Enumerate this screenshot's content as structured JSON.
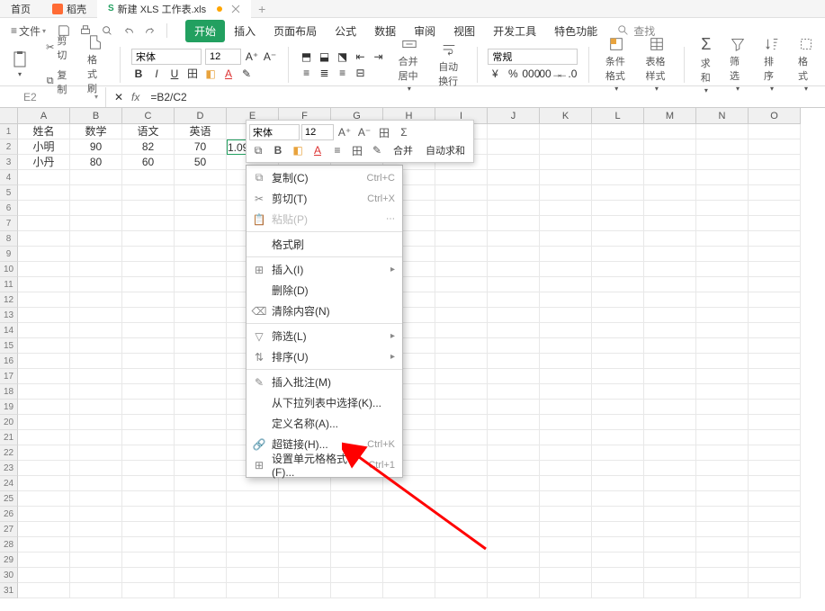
{
  "tabs": {
    "home": "首页",
    "doke": "稻壳",
    "file": "新建 XLS 工作表.xls"
  },
  "menu": {
    "file": "文件",
    "items": [
      "开始",
      "插入",
      "页面布局",
      "公式",
      "数据",
      "审阅",
      "视图",
      "开发工具",
      "特色功能"
    ],
    "search": "查找"
  },
  "ribbon": {
    "cut": "剪切",
    "copy": "复制",
    "format_painter": "格式刷",
    "font": "宋体",
    "size": "12",
    "merge": "合并居中",
    "wrap": "自动换行",
    "number_format": "常规",
    "cond_format": "条件格式",
    "table_style": "表格样式",
    "sum": "求和",
    "filter": "筛选",
    "sort": "排序",
    "format": "格式"
  },
  "formula_bar": {
    "cell": "E2",
    "formula": "=B2/C2"
  },
  "columns": [
    "A",
    "B",
    "C",
    "D",
    "E",
    "F",
    "G",
    "H",
    "I",
    "J",
    "K",
    "L",
    "M",
    "N",
    "O"
  ],
  "data": {
    "headers": [
      "姓名",
      "数学",
      "语文",
      "英语"
    ],
    "rows": [
      [
        "小明",
        "90",
        "82",
        "70",
        "1.0975609761"
      ],
      [
        "小丹",
        "80",
        "60",
        "50",
        ""
      ]
    ]
  },
  "mini_toolbar": {
    "font": "宋体",
    "size": "12",
    "merge": "合并",
    "autosum": "自动求和"
  },
  "context_menu": {
    "copy": "复制(C)",
    "copy_sc": "Ctrl+C",
    "cut": "剪切(T)",
    "cut_sc": "Ctrl+X",
    "paste": "粘贴(P)",
    "format_painter": "格式刷",
    "insert": "插入(I)",
    "delete": "删除(D)",
    "clear": "清除内容(N)",
    "filter": "筛选(L)",
    "sort": "排序(U)",
    "comment": "插入批注(M)",
    "picklist": "从下拉列表中选择(K)...",
    "define_name": "定义名称(A)...",
    "hyperlink": "超链接(H)...",
    "hyperlink_sc": "Ctrl+K",
    "format_cells": "设置单元格格式(F)...",
    "format_cells_sc": "Ctrl+1"
  }
}
